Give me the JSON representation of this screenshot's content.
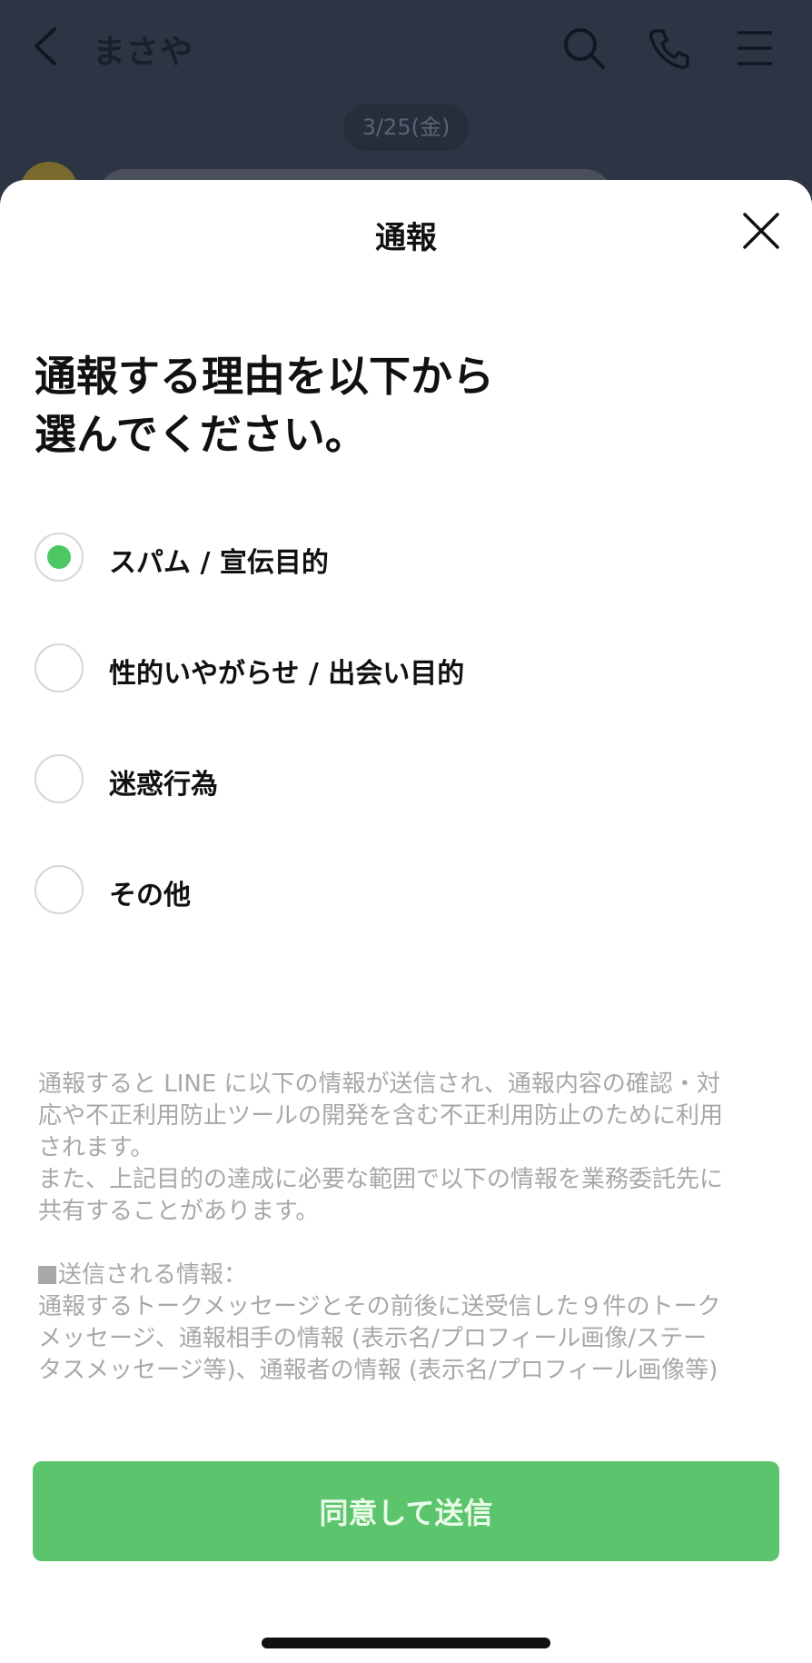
{
  "chat": {
    "title": "まさや",
    "date": "3/25(金)",
    "icons": [
      "back-icon",
      "search-icon",
      "phone-icon",
      "menu-icon"
    ]
  },
  "sheet": {
    "title": "通報",
    "heading_line1": "通報する理由を以下から",
    "heading_line2": "選んでください。",
    "options": [
      {
        "label": "スパム / 宣伝目的",
        "selected": true
      },
      {
        "label": "性的いやがらせ / 出会い目的",
        "selected": false
      },
      {
        "label": "迷惑行為",
        "selected": false
      },
      {
        "label": "その他",
        "selected": false
      }
    ],
    "notice": {
      "line1": "通報すると LINE に以下の情報が送信され、通報内容の確認・対",
      "line2": "応や不正利用防止ツールの開発を含む不正利用防止のために利用",
      "line3": "されます。",
      "line4": "また、上記目的の達成に必要な範囲で以下の情報を業務委託先に",
      "line5": "共有することがあります。",
      "info_heading": "送信される情報：",
      "info_line1": "通報するトークメッセージとその前後に送受信した９件のトーク",
      "info_line2": "メッセージ、通報相手の情報 (表示名/プロフィール画像/ステー",
      "info_line3": "タスメッセージ等)、通報者の情報 (表示名/プロフィール画像等)"
    },
    "submit_label": "同意して送信"
  },
  "colors": {
    "accent": "#4cc764",
    "button": "#5cc46d",
    "overlay": "#2d3545"
  }
}
